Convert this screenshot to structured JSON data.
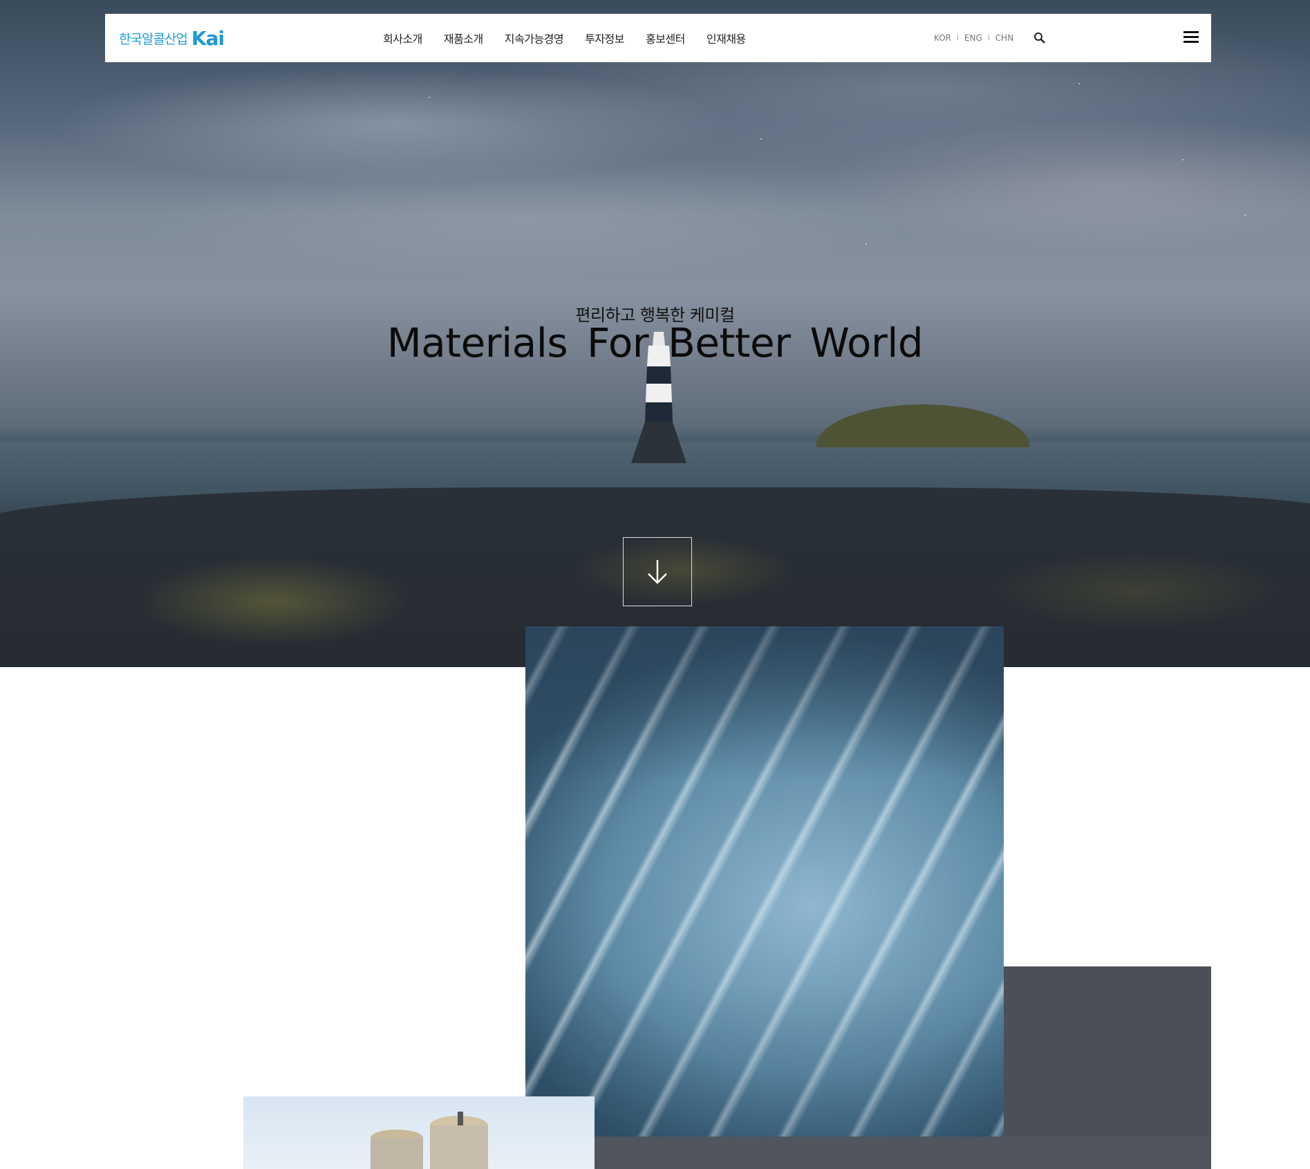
{
  "header": {
    "logo_text": "한국알콜산업",
    "logo_mark": "Kai",
    "nav": [
      "회사소개",
      "재품소개",
      "지속가능경영",
      "투자정보",
      "홍보센터",
      "인재채용"
    ],
    "languages": [
      "KOR",
      "ENG",
      "CHN"
    ],
    "lang_separator": "I",
    "search_icon": "search-icon",
    "menu_icon": "hamburger-menu-icon"
  },
  "hero": {
    "subtitle": "편리하고 행복한 케미컬",
    "title": "Materials For Better World",
    "scroll_icon": "arrow-down-icon"
  },
  "colors": {
    "brand": "#1e9ad6",
    "header_bg": "#ffffff",
    "text_dark": "#111111"
  }
}
